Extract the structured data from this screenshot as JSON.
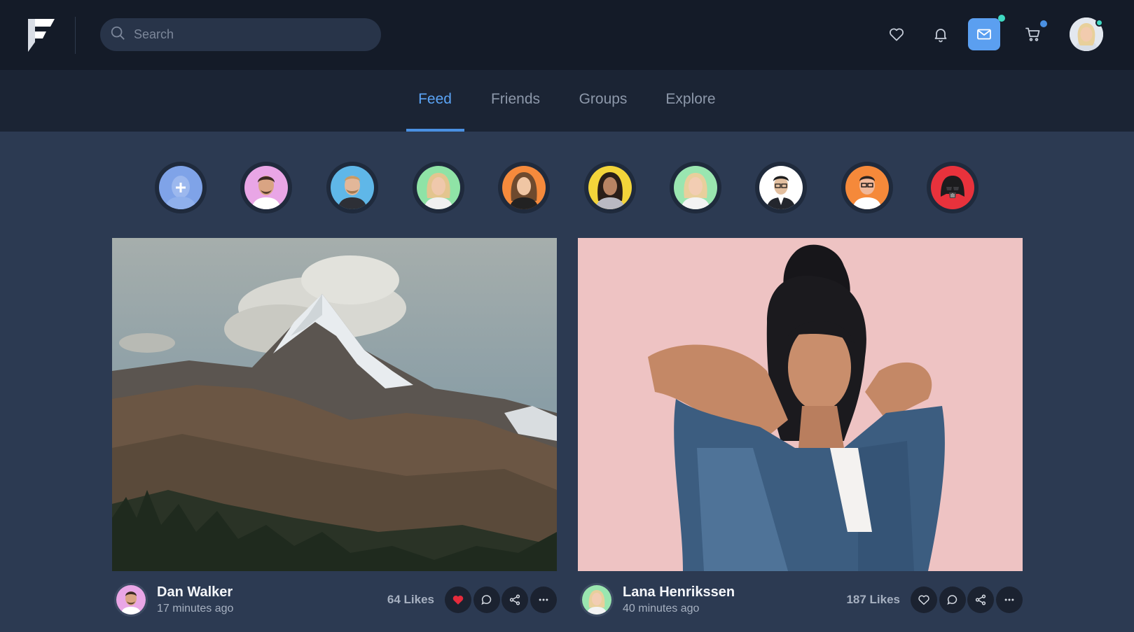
{
  "header": {
    "logo_icon": "brand-f-logo-icon",
    "search_placeholder": "Search",
    "icons": [
      "heart-icon",
      "bell-icon",
      "mail-icon",
      "cart-icon"
    ],
    "accent": "#5b9ff0"
  },
  "tabs": [
    {
      "label": "Feed",
      "active": true
    },
    {
      "label": "Friends",
      "active": false
    },
    {
      "label": "Groups",
      "active": false
    },
    {
      "label": "Explore",
      "active": false
    }
  ],
  "stories": [
    {
      "type": "add",
      "icon": "plus-icon"
    },
    {
      "type": "user"
    },
    {
      "type": "user"
    },
    {
      "type": "user"
    },
    {
      "type": "user"
    },
    {
      "type": "user"
    },
    {
      "type": "user"
    },
    {
      "type": "user"
    },
    {
      "type": "user"
    },
    {
      "type": "user"
    }
  ],
  "posts": [
    {
      "image": "mountain-photo",
      "author": "Dan Walker",
      "time": "17 minutes ago",
      "likes": "64 Likes",
      "liked": true
    },
    {
      "image": "woman-portrait-photo",
      "author": "Lana Henrikssen",
      "time": "40 minutes ago",
      "likes": "187 Likes",
      "liked": false
    }
  ],
  "colors": {
    "liked_heart": "#e52b3c",
    "online_dot": "#3fd9c2"
  }
}
